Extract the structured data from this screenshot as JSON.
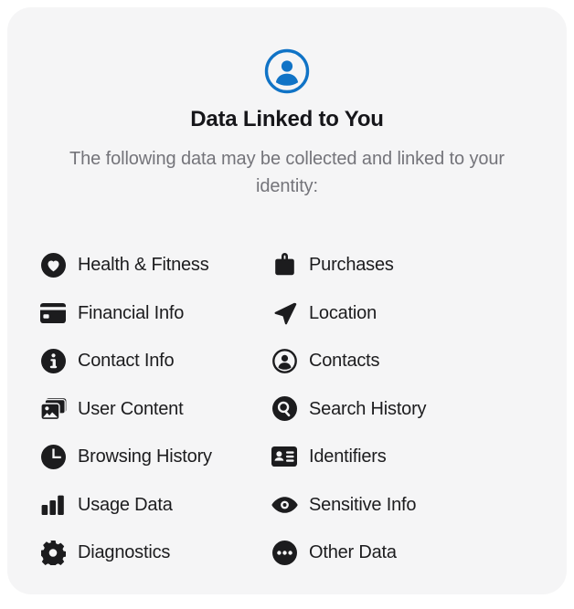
{
  "card": {
    "header_icon": "person-circle-icon",
    "header_icon_color": "#1073c6",
    "title": "Data Linked to You",
    "subtitle": "The following data may be collected and linked to your identity:",
    "background_color": "#f5f5f6",
    "title_color": "#16161a",
    "subtitle_color": "#74747a",
    "icon_color": "#1c1c1e"
  },
  "categories": {
    "left_column": [
      {
        "label": "Health & Fitness",
        "icon": "heart-circle-icon"
      },
      {
        "label": "Financial Info",
        "icon": "credit-card-icon"
      },
      {
        "label": "Contact Info",
        "icon": "info-circle-icon"
      },
      {
        "label": "User Content",
        "icon": "photo-stack-icon"
      },
      {
        "label": "Browsing History",
        "icon": "clock-icon"
      },
      {
        "label": "Usage Data",
        "icon": "bar-chart-icon"
      },
      {
        "label": "Diagnostics",
        "icon": "gear-icon"
      }
    ],
    "right_column": [
      {
        "label": "Purchases",
        "icon": "shopping-bag-icon"
      },
      {
        "label": "Location",
        "icon": "navigation-arrow-icon"
      },
      {
        "label": "Contacts",
        "icon": "person-circle-icon"
      },
      {
        "label": "Search History",
        "icon": "magnifier-circle-icon"
      },
      {
        "label": "Identifiers",
        "icon": "id-card-icon"
      },
      {
        "label": "Sensitive Info",
        "icon": "eye-icon"
      },
      {
        "label": "Other Data",
        "icon": "ellipsis-circle-icon"
      }
    ]
  }
}
